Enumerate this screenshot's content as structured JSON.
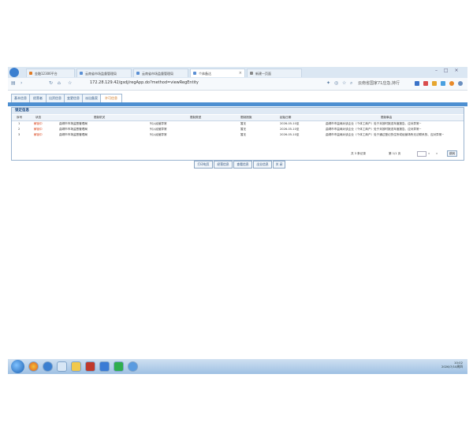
{
  "browser": {
    "tabs": [
      {
        "label": "金融12306平台"
      },
      {
        "label": "云南省市场监督管理局"
      },
      {
        "label": "云南省市场监督管理局"
      },
      {
        "label": "个体备达",
        "active": true
      },
      {
        "label": "新建一页面"
      }
    ],
    "url": "172.28.129.42/gsdj/regApp.do?method=viewRegEntity",
    "search_hint": "云南省国家71应急,持行"
  },
  "app": {
    "tabs": [
      "基本信息",
      "经营者",
      "出资信息",
      "变更信息",
      "派出备案",
      "许可信息"
    ],
    "active_tab_index": 5,
    "panel_title": "锁定信息",
    "headers": [
      "序号",
      "状态",
      "限制机关",
      "限制类型",
      "限制措施",
      "起始日期",
      "限制事由"
    ],
    "rows": [
      [
        "1",
        "解锁中",
        "曲靖市市场监督管理局",
        "列入经营异常",
        "暂无",
        "2026-05-10至",
        "曲靖市市监局对该企业（个体工商户）处于未按时报送年度报告、应对异常~"
      ],
      [
        "2",
        "解锁中",
        "曲靖市市场监督管理局",
        "列入经营异常",
        "暂无",
        "2026-05-10至",
        "曲靖市市监局对该企业（个体工商户）处于未按时报送年度报告、应对异常~"
      ],
      [
        "3",
        "解锁中",
        "曲靖市市场监督管理局",
        "列入经营异常",
        "暂无",
        "2026-05-10至",
        "曲靖市市监局对该企业（个体工商户）处于通过登记的住所或经营场所无法联系的、应对异常~"
      ]
    ],
    "pager": {
      "total": "共 3 条记录",
      "page": "第 1/1 页",
      "goto": "跳转"
    },
    "buttons": [
      "打印电页",
      "经营信息",
      "查看信息",
      "出业信息",
      "关 闭"
    ]
  },
  "taskbar": {
    "time": "10:02",
    "date": "2026/7/10周四"
  },
  "colors": {
    "accent": "#4d8fd1",
    "status_red": "#d9441b",
    "tab_active": "#d0741b"
  }
}
